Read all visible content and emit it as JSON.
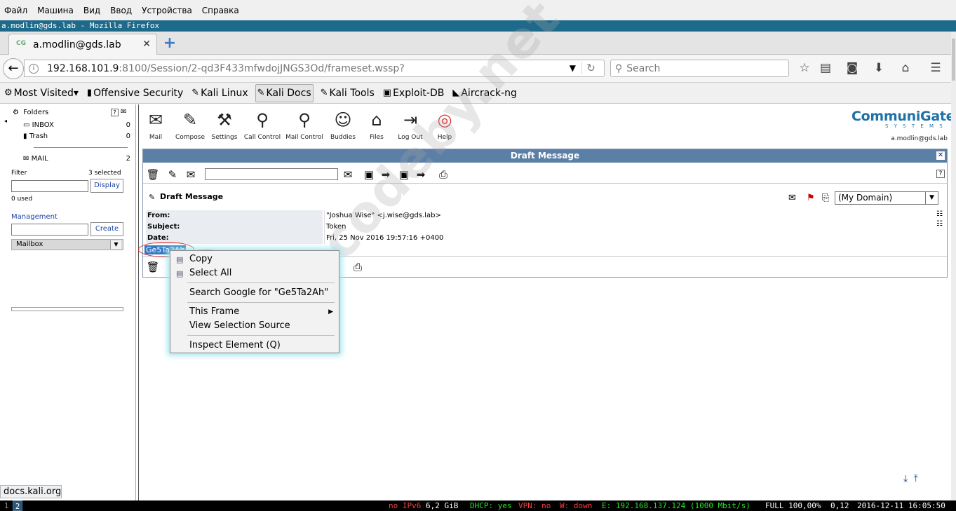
{
  "vm_menu": [
    "Файл",
    "Машина",
    "Вид",
    "Ввод",
    "Устройства",
    "Справка"
  ],
  "window_title": "a.modlin@gds.lab - Mozilla Firefox",
  "tab": {
    "favicon": "CG",
    "title": "a.modlin@gds.lab",
    "close": "✕",
    "new_tab": "+"
  },
  "nav": {
    "url_host": "192.168.101.9",
    "url_rest": ":8100/Session/2-qd3F433mfwdojJNGS3Od/frameset.wssp?",
    "search_placeholder": "Search"
  },
  "bookmarks": [
    {
      "label": "Most Visited",
      "icon": "gear-icon",
      "glyph": "⚙",
      "dropdown": "▾"
    },
    {
      "label": "Offensive Security",
      "icon": "offsec-icon",
      "glyph": "▮"
    },
    {
      "label": "Kali Linux",
      "icon": "kali-icon",
      "glyph": "✎"
    },
    {
      "label": "Kali Docs",
      "icon": "kali-icon",
      "glyph": "✎"
    },
    {
      "label": "Kali Tools",
      "icon": "kali-icon",
      "glyph": "✎"
    },
    {
      "label": "Exploit-DB",
      "icon": "exploitdb-icon",
      "glyph": "▣"
    },
    {
      "label": "Aircrack-ng",
      "icon": "aircrack-icon",
      "glyph": "◣"
    }
  ],
  "left": {
    "folders_label": "Folders",
    "help": "?",
    "folders": [
      {
        "name": "INBOX",
        "count": "0"
      },
      {
        "name": "Trash",
        "count": "0"
      },
      {
        "name": "MAIL",
        "count": "2"
      }
    ],
    "filter_label": "Filter",
    "selected_label": "3 selected",
    "display_btn": "Display",
    "used_label": "0 used",
    "management_label": "Management",
    "create_btn": "Create",
    "mailbox_select": "Mailbox"
  },
  "status_url": "docs.kali.org",
  "app": {
    "tools": [
      "Mail",
      "Compose",
      "Settings",
      "Call Control",
      "Mail Control",
      "Buddies",
      "Files",
      "Log Out",
      "Help"
    ],
    "logo": "CommuniGate",
    "logo_sub": "S Y S T E M S",
    "user": "a.modlin@gds.lab"
  },
  "message": {
    "frame_title": "Draft Message",
    "close": "✕",
    "help": "?",
    "draft_title": "Draft Message",
    "domain": "(My Domain)",
    "headers": [
      {
        "label": "From:",
        "value": "\"Joshua Wise\" <j.wise@gds.lab>"
      },
      {
        "label": "Subject:",
        "value": "Token"
      },
      {
        "label": "Date:",
        "value": "Fri, 25 Nov 2016 19:57:16 +0400"
      }
    ],
    "body_selected": "Ge5Ta2Ah"
  },
  "context_menu": {
    "copy": "Copy",
    "select_all": "Select All",
    "search_google": "Search Google for \"Ge5Ta2Ah\"",
    "this_frame": "This Frame",
    "view_source": "View Selection Source",
    "inspect": "Inspect Element (Q)"
  },
  "watermark": "codeby.net",
  "statusbar": {
    "workspaces": [
      "1",
      "2"
    ],
    "ipv6": "no IPv6",
    "disk": "6,2 GiB",
    "dhcp": "DHCP: yes",
    "vpn": "VPN: no",
    "wifi": "W: down",
    "eth": "E: 192.168.137.124 (1000 Mbit/s)",
    "battery": "FULL 100,00%",
    "load": "0,12",
    "datetime": "2016-12-11 16:05:50"
  },
  "colors": {
    "title_bar": "#1e6a8a",
    "frame_title": "#5b7fa6",
    "selection": "#3378c4",
    "annotation": "#e0201e",
    "menu_glow": "#9fe6ee",
    "logo": "#1e72a8"
  }
}
